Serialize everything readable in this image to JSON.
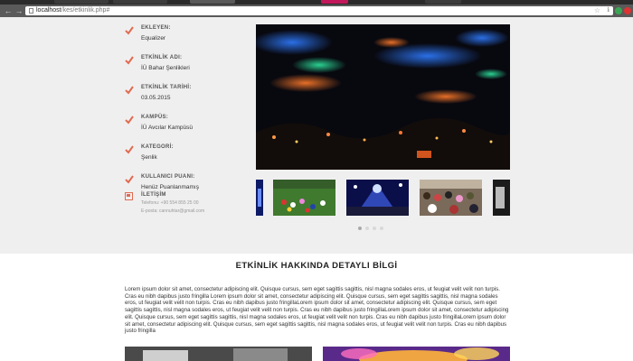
{
  "browser": {
    "url_host": "localhost",
    "url_path": "/kes/etkinlik.php#",
    "back_icon": "back-arrow-icon",
    "forward_icon": "forward-arrow-icon",
    "reload_icon": "reload-icon",
    "star_icon": "bookmark-star-icon"
  },
  "event_info": {
    "items": [
      {
        "label": "EKLEYEN:",
        "value": "Equalizer"
      },
      {
        "label": "ETKİNLİK ADI:",
        "value": "İÜ Bahar Şenlikleri"
      },
      {
        "label": "ETKİNLİK TARİHİ:",
        "value": "03.05.2015"
      },
      {
        "label": "KAMPÜS:",
        "value": "İÜ Avcılar Kampüsü"
      },
      {
        "label": "KATEGORİ:",
        "value": "Şenlik"
      },
      {
        "label": "KULLANICI PUANI:",
        "value": "Henüz Puanlanmamış"
      }
    ],
    "contact": {
      "title": "İLETİŞİM",
      "phone": "Telefonu: +90 554 855 25 00",
      "email": "E-posta: cannuhtar@gmail.com"
    }
  },
  "gallery": {
    "thumbnail_count": 5,
    "dots": 4,
    "active_dot": 0
  },
  "details": {
    "title": "ETKİNLİK HAKKINDA DETAYLI BİLGİ",
    "body": "Lorem ipsum dolor sit amet, consectetur adipiscing elit. Quisque cursus, sem eget sagittis sagittis, nisl magna sodales eros, ut feugiat velit velit non turpis. Cras eu nibh dapibus justo fringilla Lorem ipsum dolor sit amet, consectetur adipiscing elit. Quisque cursus, sem eget sagittis sagittis, nisl magna sodales eros, ut feugiat velit velit non turpis. Cras eu nibh dapibus justo fringillaLorem ipsum dolor sit amet, consectetur adipiscing elit. Quisque cursus, sem eget sagittis sagittis, nisl magna sodales eros, ut feugiat velit velit non turpis. Cras eu nibh dapibus justo fringillaLorem ipsum dolor sit amet, consectetur adipiscing elit. Quisque cursus, sem eget sagittis sagittis, nisl magna sodales eros, ut feugiat velit velit non turpis. Cras eu nibh dapibus justo fringillaLorem ipsum dolor sit amet, consectetur adipiscing elit. Quisque cursus, sem eget sagittis sagittis, nisl magna sodales eros, ut feugiat velit velit non turpis. Cras eu nibh dapibus justo fringilla"
  },
  "colors": {
    "accent": "#e06b52",
    "upper_bg": "#f0efef"
  }
}
